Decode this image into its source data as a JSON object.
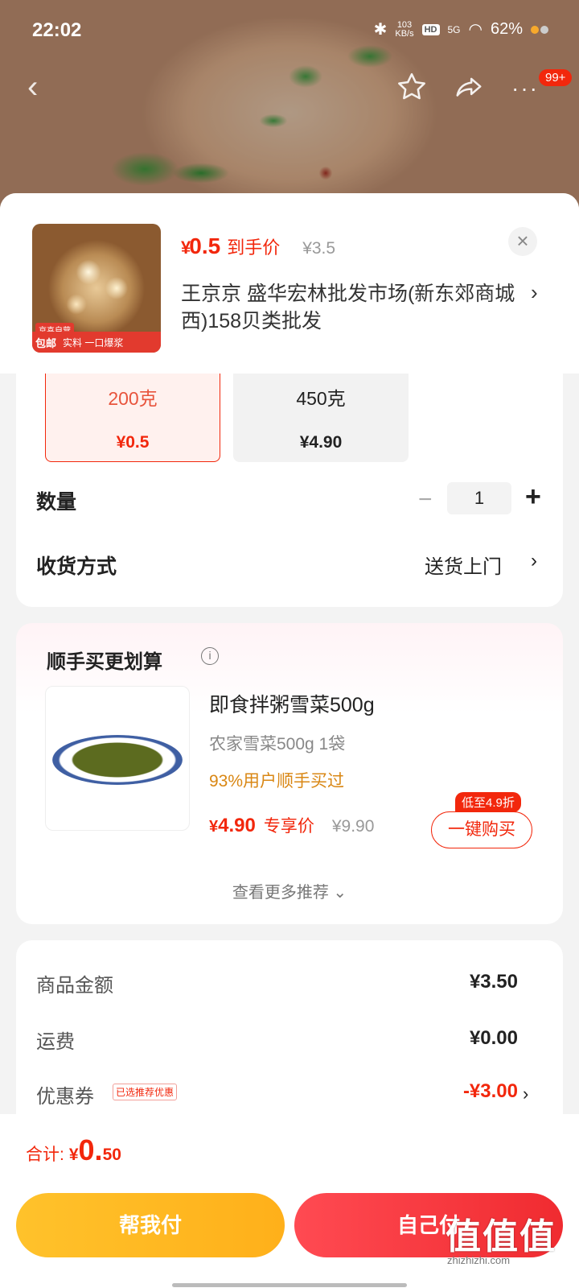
{
  "status_bar": {
    "time": "22:02",
    "net_speed": "103\nKB/s",
    "hd": "HD",
    "signal": "5G",
    "battery": "62%"
  },
  "nav": {
    "back_glyph": "‹",
    "more_glyph": "···",
    "badge": "99+"
  },
  "product": {
    "thumb_band_tag": "京喜自营",
    "thumb_band_mail": "包邮",
    "thumb_band_text": "实料 一口爆浆",
    "price_currency": "¥",
    "price_value": "0.5",
    "price_label": "到手价",
    "price_original": "¥3.5",
    "store": "王京京  盛华宏林批发市场(新东郊商城西)158贝类批发"
  },
  "specs": [
    {
      "name": "200克",
      "price": "¥0.5",
      "selected": true
    },
    {
      "name": "450克",
      "price": "¥4.90",
      "selected": false
    }
  ],
  "quantity": {
    "label": "数量",
    "value": "1",
    "minus": "−",
    "plus": "+"
  },
  "delivery": {
    "label": "收货方式",
    "value": "送货上门"
  },
  "recommend": {
    "title": "顺手买更划算",
    "item": {
      "name": "即食拌粥雪菜500g",
      "spec": "农家雪菜500g   1袋",
      "hint": "93%用户顺手买过",
      "price_currency": "¥",
      "price_value": "4.90",
      "price_label": "专享价",
      "price_original": "¥9.90",
      "badge": "低至4.9折",
      "buy_label": "一键购买"
    },
    "more_label": "查看更多推荐 ⌄"
  },
  "summary": {
    "goods_label": "商品金额",
    "goods_value": "¥3.50",
    "shipping_label": "运费",
    "shipping_value": "¥0.00",
    "coupon_label": "优惠券",
    "coupon_tag": "已选推荐优惠",
    "coupon_value": "-¥3.00"
  },
  "footer": {
    "total_label": "合计:",
    "total_currency": "¥",
    "total_int": "0.",
    "total_dec": "50",
    "help_pay": "帮我付",
    "self_pay": "自己付",
    "watermark_logo": "值值值",
    "watermark_url": "zhizhizhi.com"
  },
  "colors": {
    "accent": "#f2270c",
    "help_button": "#ffb81f",
    "self_button": "#f3343a"
  }
}
